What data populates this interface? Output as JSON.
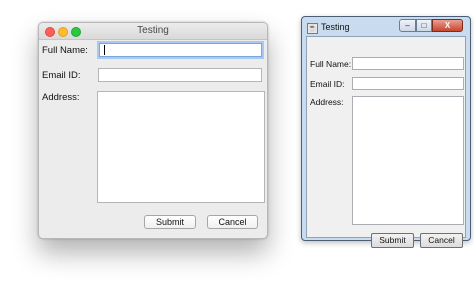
{
  "mac_window": {
    "title": "Testing",
    "labels": {
      "full_name": "Full Name:",
      "email": "Email ID:",
      "address": "Address:"
    },
    "fields": {
      "full_name": "",
      "email": "",
      "address": ""
    },
    "buttons": {
      "submit": "Submit",
      "cancel": "Cancel"
    }
  },
  "win_window": {
    "title": "Testing",
    "controls": {
      "minimize": "–",
      "maximize": "□",
      "close": "X"
    },
    "labels": {
      "full_name": "Full Name:",
      "email": "Email ID:",
      "address": "Address:"
    },
    "fields": {
      "full_name": "",
      "email": "",
      "address": ""
    },
    "buttons": {
      "submit": "Submit",
      "cancel": "Cancel"
    }
  }
}
